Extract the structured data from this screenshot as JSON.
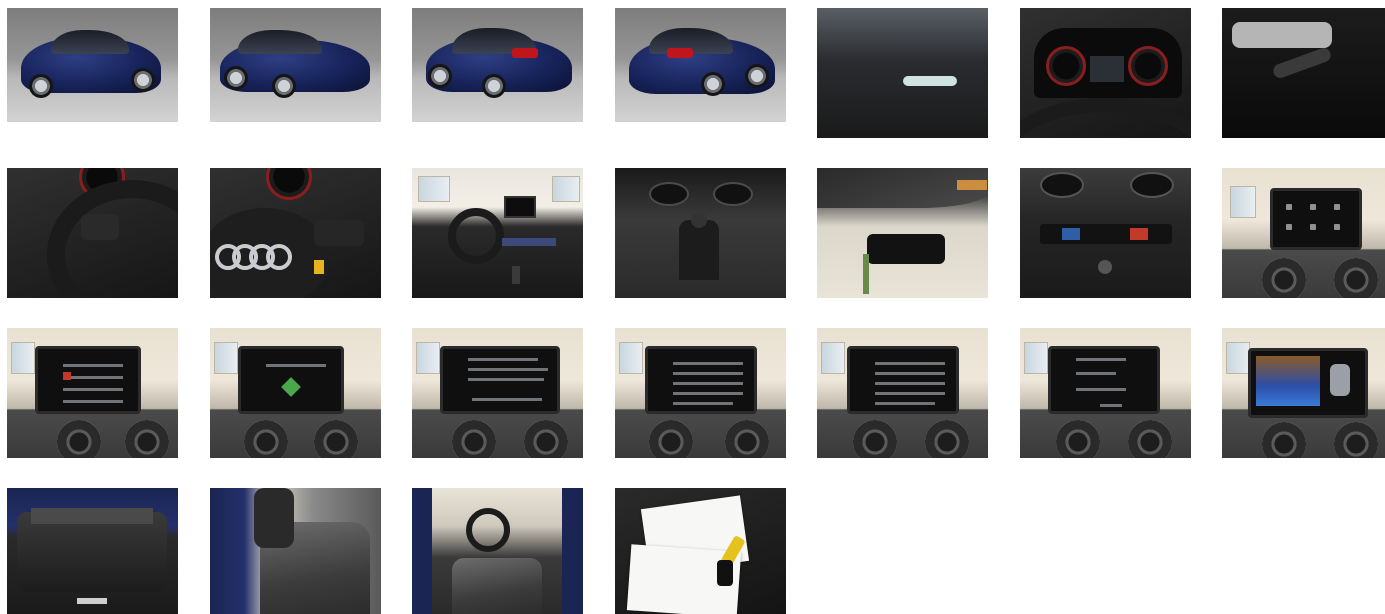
{
  "gallery": {
    "photos": [
      {
        "alt": ""
      },
      {
        "alt": ""
      },
      {
        "alt": ""
      },
      {
        "alt": ""
      },
      {
        "alt": ""
      },
      {
        "alt": ""
      },
      {
        "alt": ""
      },
      {
        "alt": ""
      },
      {
        "alt": ""
      },
      {
        "alt": ""
      },
      {
        "alt": ""
      },
      {
        "alt": ""
      },
      {
        "alt": ""
      },
      {
        "alt": ""
      },
      {
        "alt": ""
      },
      {
        "alt": ""
      },
      {
        "alt": ""
      },
      {
        "alt": ""
      },
      {
        "alt": ""
      },
      {
        "alt": ""
      },
      {
        "alt": ""
      },
      {
        "alt": ""
      },
      {
        "alt": ""
      },
      {
        "alt": ""
      },
      {
        "alt": ""
      }
    ],
    "photo_count": 25
  },
  "colors": {
    "car_paint": "#17235a",
    "tail_light": "#c0151d",
    "background": "#ffffff"
  }
}
